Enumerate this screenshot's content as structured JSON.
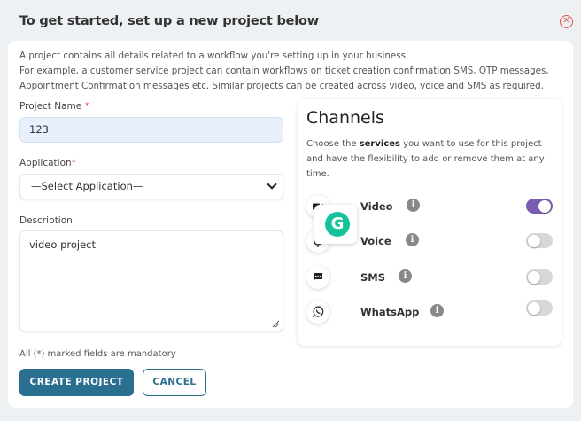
{
  "modal": {
    "title": "To get started, set up a new project below",
    "close_icon": "close-circle-icon"
  },
  "intro": {
    "line1": "A project contains all details related to a workflow you're setting up in your business.",
    "line2": "For example, a customer service project can contain workflows on ticket creation confirmation SMS, OTP messages,",
    "line3": "Appointment Confirmation messages etc. Similar projects can be created across video, voice and SMS as required."
  },
  "form": {
    "project_name_label": "Project Name",
    "project_name_value": "123",
    "application_label": "Application",
    "application_selected": "—Select Application—",
    "description_label": "Description",
    "description_value": "video project",
    "required_marker": "*",
    "mandatory_note": "All (*) marked fields are mandatory",
    "create_button": "CREATE PROJECT",
    "cancel_button": "CANCEL"
  },
  "channels": {
    "title": "Channels",
    "desc_prefix": "Choose the ",
    "desc_bold": "services",
    "desc_suffix": " you want to use for this project and have the flexibility to add or remove them at any time.",
    "items": [
      {
        "label": "Video",
        "icon": "video-camera-icon",
        "enabled": true
      },
      {
        "label": "Voice",
        "icon": "microphone-icon",
        "enabled": false
      },
      {
        "label": "SMS",
        "icon": "message-icon",
        "enabled": false
      },
      {
        "label": "WhatsApp",
        "icon": "whatsapp-icon",
        "enabled": false
      }
    ]
  },
  "overlay": {
    "grammarly_letter": "G",
    "grammarly_icon": "grammarly-icon"
  },
  "colors": {
    "primary": "#2a6f8f",
    "toggle_on": "#7b5cb3",
    "required": "#e05252",
    "grammarly": "#15c39a"
  }
}
